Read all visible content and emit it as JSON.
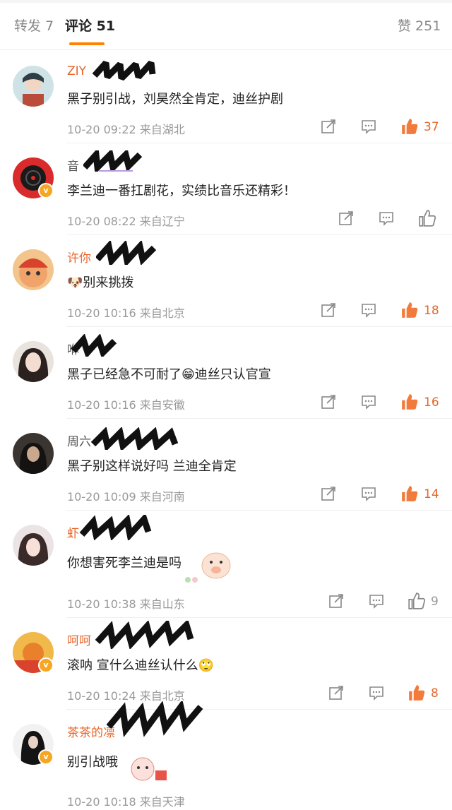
{
  "tabs": {
    "repost": "转发 7",
    "comments": "评论 51",
    "likes": "赞 251"
  },
  "colors": {
    "accent": "#ff8200",
    "username": "#e8652a",
    "liked": "#f27a3a",
    "meta": "#999999"
  },
  "comments": [
    {
      "name": "ZIY",
      "text": "黑子别引战，刘昊然全肯定，迪丝护剧",
      "time": "10-20 09:22",
      "loc": "来自湖北",
      "likes": "37",
      "liked": true
    },
    {
      "name": "音",
      "text": "李兰迪一番扛剧花，实绩比音乐还精彩！",
      "time": "10-20 08:22",
      "loc": "来自辽宁",
      "likes": "",
      "liked": false
    },
    {
      "name": "许你",
      "text": "🐶别来挑拨",
      "time": "10-20 10:16",
      "loc": "来自北京",
      "likes": "18",
      "liked": true
    },
    {
      "name": "咻",
      "text": "黑子已经急不可耐了😁迪丝只认官宣",
      "time": "10-20 10:16",
      "loc": "来自安徽",
      "likes": "16",
      "liked": true
    },
    {
      "name": "周六",
      "text": "黑子别这样说好吗 兰迪全肯定",
      "time": "10-20 10:09",
      "loc": "来自河南",
      "likes": "14",
      "liked": true
    },
    {
      "name": "虾",
      "text": "你想害死李兰迪是吗",
      "time": "10-20 10:38",
      "loc": "来自山东",
      "likes": "9",
      "liked": false
    },
    {
      "name": "呵呵",
      "text": "滚呐 宣什么迪丝认什么🙄",
      "time": "10-20 10:24",
      "loc": "来自北京",
      "likes": "8",
      "liked": true
    },
    {
      "name": "茶茶的凛",
      "text": "别引战哦",
      "time": "10-20 10:18",
      "loc": "来自天津",
      "likes": "",
      "liked": false
    }
  ]
}
